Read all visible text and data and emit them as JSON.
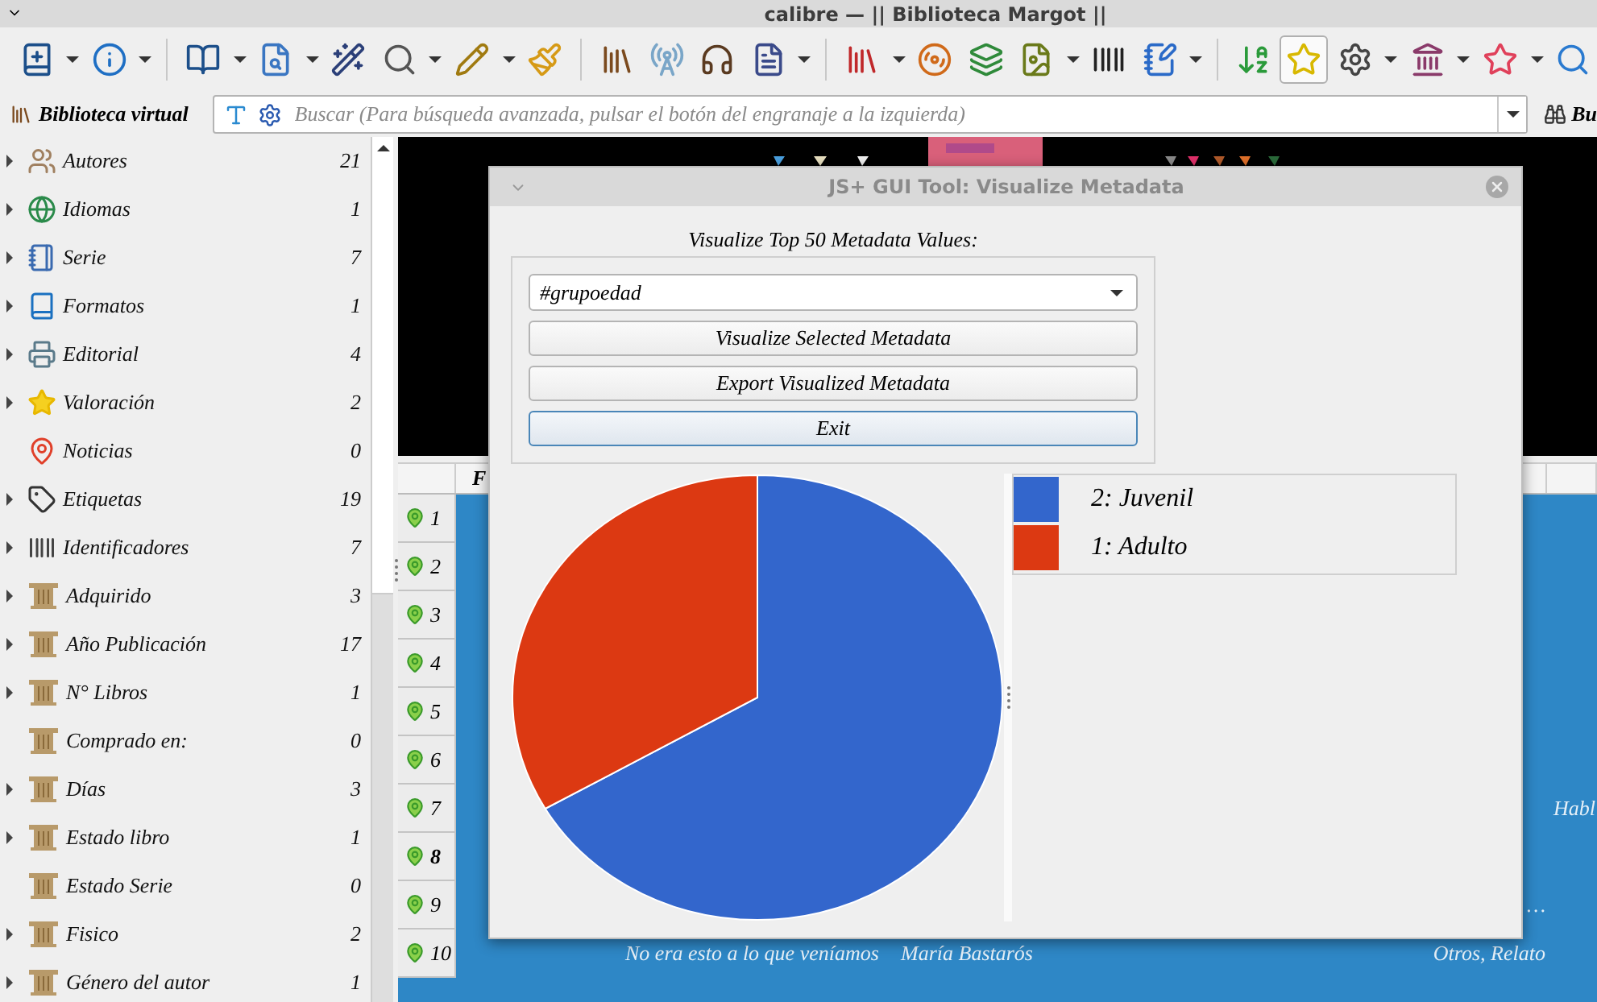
{
  "window": {
    "title": "calibre — || Biblioteca Margot ||"
  },
  "toolbar": [
    [
      {
        "dropdown": true,
        "pressed": false
      },
      {
        "dropdown": true,
        "pressed": false
      }
    ],
    [
      {
        "dropdown": true,
        "pressed": false
      },
      {
        "dropdown": true,
        "pressed": false
      },
      {
        "dropdown": false,
        "pressed": false
      },
      {
        "dropdown": true,
        "pressed": false
      },
      {
        "dropdown": true,
        "pressed": false
      },
      {
        "dropdown": false,
        "pressed": false
      }
    ],
    [
      {
        "dropdown": false,
        "pressed": false
      },
      {
        "dropdown": false,
        "pressed": false
      },
      {
        "dropdown": false,
        "pressed": false
      },
      {
        "dropdown": true,
        "pressed": false
      }
    ],
    [
      {
        "dropdown": true,
        "pressed": false
      },
      {
        "dropdown": false,
        "pressed": false
      },
      {
        "dropdown": false,
        "pressed": false
      },
      {
        "dropdown": true,
        "pressed": false
      },
      {
        "dropdown": false,
        "pressed": false
      },
      {
        "dropdown": true,
        "pressed": false
      }
    ],
    [
      {
        "dropdown": false,
        "pressed": false
      },
      {
        "dropdown": false,
        "pressed": true
      },
      {
        "dropdown": true,
        "pressed": false
      },
      {
        "dropdown": true,
        "pressed": false
      },
      {
        "dropdown": true,
        "pressed": false
      },
      {
        "dropdown": false,
        "pressed": false
      }
    ]
  ],
  "search_bar": {
    "virtual_library": "Biblioteca virtual",
    "placeholder": "Buscar (Para búsqueda avanzada, pulsar el botón del engranaje a la izquierda)",
    "saved_search": "Bu"
  },
  "sidebar": {
    "items": [
      {
        "label": "Autores",
        "count": "21",
        "expandable": true
      },
      {
        "label": "Idiomas",
        "count": "1",
        "expandable": true
      },
      {
        "label": "Serie",
        "count": "7",
        "expandable": true
      },
      {
        "label": "Formatos",
        "count": "1",
        "expandable": true
      },
      {
        "label": "Editorial",
        "count": "4",
        "expandable": true
      },
      {
        "label": "Valoración",
        "count": "2",
        "expandable": true
      },
      {
        "label": "Noticias",
        "count": "0",
        "expandable": false
      },
      {
        "label": "Etiquetas",
        "count": "19",
        "expandable": true
      },
      {
        "label": "Identificadores",
        "count": "7",
        "expandable": true
      },
      {
        "label": "Adquirido",
        "count": "3",
        "expandable": true
      },
      {
        "label": "Año Publicación",
        "count": "17",
        "expandable": true
      },
      {
        "label": "N° Libros",
        "count": "1",
        "expandable": true
      },
      {
        "label": "Comprado en:",
        "count": "0",
        "expandable": false
      },
      {
        "label": "Días",
        "count": "3",
        "expandable": true
      },
      {
        "label": "Estado libro",
        "count": "1",
        "expandable": true
      },
      {
        "label": "Estado Serie",
        "count": "0",
        "expandable": false
      },
      {
        "label": "Fisico",
        "count": "2",
        "expandable": true
      },
      {
        "label": "Género del autor",
        "count": "1",
        "expandable": true
      }
    ]
  },
  "table": {
    "columns": [
      "F"
    ],
    "rows": [
      {
        "number": "1",
        "selected": false,
        "cells": [
          "",
          "",
          "",
          ""
        ]
      },
      {
        "number": "2",
        "selected": false,
        "cells": [
          "",
          "",
          "",
          ""
        ]
      },
      {
        "number": "3",
        "selected": false,
        "cells": [
          "",
          "",
          "",
          ""
        ]
      },
      {
        "number": "4",
        "selected": false,
        "cells": [
          "",
          "",
          "",
          ""
        ]
      },
      {
        "number": "5",
        "selected": false,
        "cells": [
          "",
          "",
          "",
          ""
        ]
      },
      {
        "number": "6",
        "selected": false,
        "cells": [
          "",
          "",
          "",
          ""
        ]
      },
      {
        "number": "7",
        "selected": false,
        "cells": [
          "",
          "",
          "",
          "Habl"
        ]
      },
      {
        "number": "8",
        "selected": true,
        "cells": [
          "",
          "",
          "",
          ""
        ]
      },
      {
        "number": "9",
        "selected": false,
        "cells": [
          "",
          "",
          "…",
          ""
        ]
      },
      {
        "number": "10",
        "selected": false,
        "cells": [
          "No era esto a lo que veníamos",
          "María Bastarós",
          "Otros, Relato",
          ""
        ]
      }
    ]
  },
  "dialog": {
    "title": "JS+ GUI Tool: Visualize Metadata",
    "heading": "Visualize Top 50 Metadata Values:",
    "combo": "#grupoedad",
    "buttons": [
      {
        "label": "Visualize Selected Metadata",
        "focused": false
      },
      {
        "label": "Export Visualized Metadata",
        "focused": false
      },
      {
        "label": "Exit",
        "focused": true
      }
    ],
    "chart_data": {
      "type": "pie",
      "categories": [
        "2: Juvenil",
        "1: Adulto"
      ],
      "values": [
        2,
        1
      ],
      "colors": [
        "#3366cc",
        "#dc3912"
      ]
    }
  }
}
